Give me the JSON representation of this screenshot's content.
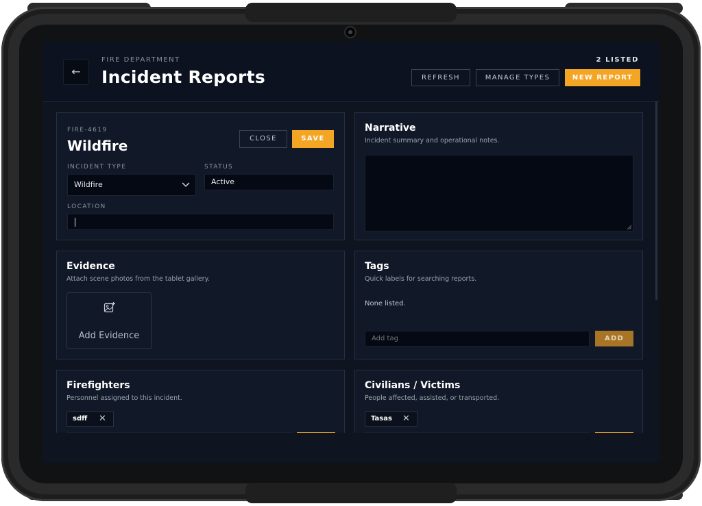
{
  "header": {
    "kicker": "FIRE DEPARTMENT",
    "title": "Incident Reports",
    "count": "2 LISTED",
    "refresh_label": "REFRESH",
    "manage_label": "MANAGE TYPES",
    "new_label": "NEW REPORT",
    "back_icon": "←"
  },
  "report": {
    "id": "FIRE-4619",
    "name": "Wildfire",
    "close_label": "CLOSE",
    "save_label": "SAVE",
    "type_label": "INCIDENT TYPE",
    "type_value": "Wildfire",
    "status_label": "STATUS",
    "status_value": "Active",
    "location_label": "LOCATION",
    "location_value": ""
  },
  "narrative": {
    "title": "Narrative",
    "subtitle": "Incident summary and operational notes.",
    "value": ""
  },
  "evidence": {
    "title": "Evidence",
    "subtitle": "Attach scene photos from the tablet gallery.",
    "add_label": "Add Evidence"
  },
  "tags": {
    "title": "Tags",
    "subtitle": "Quick labels for searching reports.",
    "empty": "None listed.",
    "input_placeholder": "Add tag",
    "add_label": "ADD"
  },
  "firefighters": {
    "title": "Firefighters",
    "subtitle": "Personnel assigned to this incident.",
    "chips": [
      "sdff"
    ]
  },
  "civilians": {
    "title": "Civilians / Victims",
    "subtitle": "People affected, assisted, or transported.",
    "chips": [
      "Tasas"
    ]
  },
  "icons": {
    "back": "arrow-left-icon",
    "chevron": "chevron-down-icon",
    "add_image": "image-add-icon",
    "remove": "close-icon"
  },
  "colors": {
    "accent": "#f4a524",
    "background": "#0e1420",
    "card": "#111827",
    "input": "#050913"
  }
}
